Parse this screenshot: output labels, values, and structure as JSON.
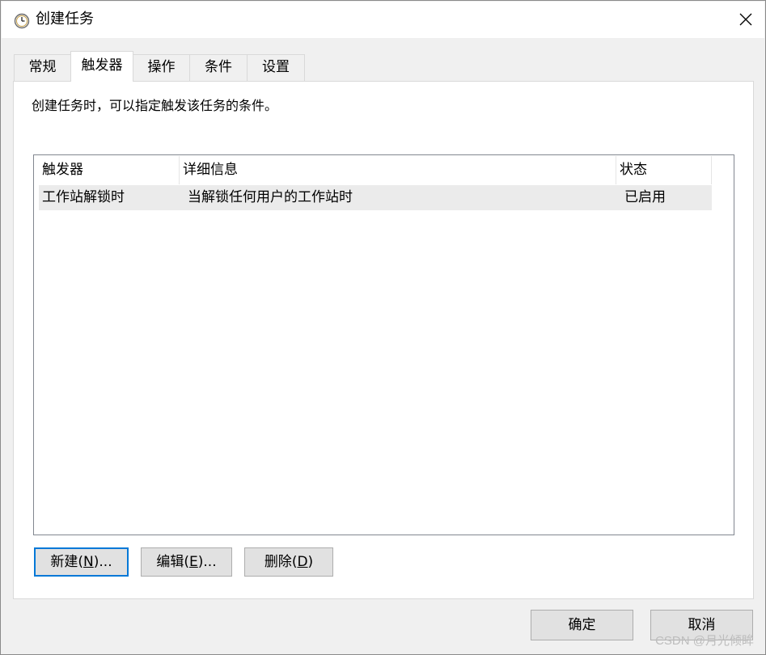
{
  "window": {
    "title": "创建任务",
    "icon": "clock-icon",
    "close_icon": "close-icon"
  },
  "tabs": [
    {
      "label": "常规",
      "active": false
    },
    {
      "label": "触发器",
      "active": true
    },
    {
      "label": "操作",
      "active": false
    },
    {
      "label": "条件",
      "active": false
    },
    {
      "label": "设置",
      "active": false
    }
  ],
  "panel": {
    "description": "创建任务时，可以指定触发该任务的条件。",
    "columns": [
      "触发器",
      "详细信息",
      "状态"
    ],
    "rows": [
      {
        "trigger": "工作站解锁时",
        "details": "当解锁任何用户的工作站时",
        "status": "已启用"
      }
    ],
    "buttons": {
      "new_label": "新建",
      "new_accel": "(N)...",
      "new_accel_prefix": "(",
      "new_accel_key": "N",
      "new_accel_suffix": ")...",
      "edit_label": "编辑",
      "edit_accel_prefix": "(",
      "edit_accel_key": "E",
      "edit_accel_suffix": ")...",
      "delete_label": "删除",
      "delete_accel_prefix": "(",
      "delete_accel_key": "D",
      "delete_accel_suffix": ")"
    }
  },
  "footer": {
    "ok_label": "确定",
    "cancel_label": "取消"
  },
  "watermark": "CSDN @月光倾眸",
  "colors": {
    "accent": "#0078d7",
    "selected_row": "#ebebeb",
    "button_face": "#e1e1e1"
  }
}
